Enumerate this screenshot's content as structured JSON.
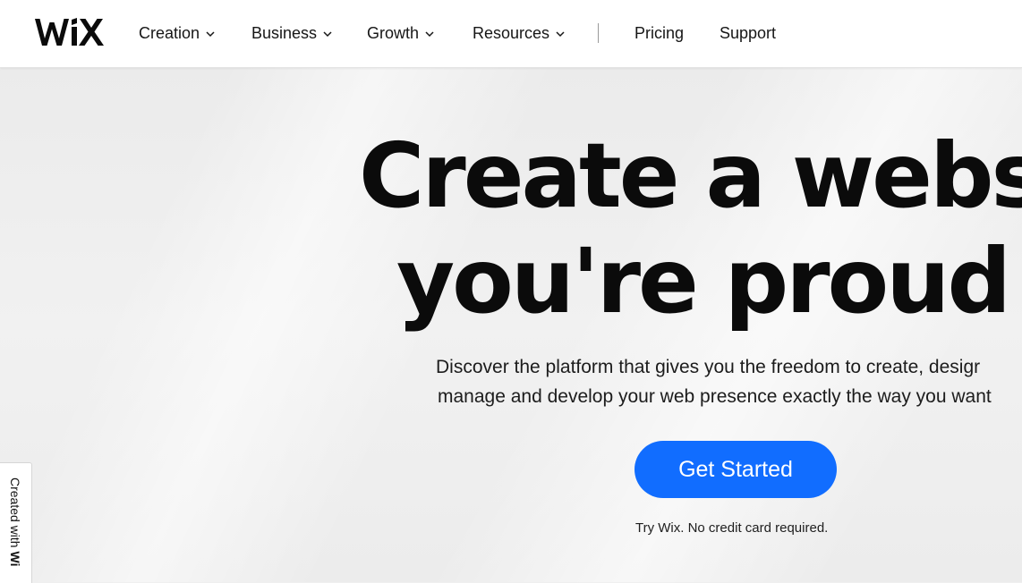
{
  "brand": {
    "logo_text": "WiX",
    "accent_color": "#116dff"
  },
  "nav": {
    "items": [
      {
        "label": "Creation",
        "icon": "chevron-down-icon"
      },
      {
        "label": "Business",
        "icon": "chevron-down-icon"
      },
      {
        "label": "Growth",
        "icon": "chevron-down-icon"
      },
      {
        "label": "Resources",
        "icon": "chevron-down-icon"
      }
    ],
    "links": [
      {
        "label": "Pricing"
      },
      {
        "label": "Support"
      }
    ]
  },
  "hero": {
    "title_line1": "Create a websi",
    "title_line2": "you're proud o",
    "subtitle_line1": "Discover the platform that gives you the freedom to create, desigr",
    "subtitle_line2": "manage and develop your web presence exactly the way you want",
    "cta_label": "Get Started",
    "cta_note": "Try Wix. No credit card required."
  },
  "side_badge": {
    "prefix": "Created with ",
    "brand": "Wi"
  }
}
